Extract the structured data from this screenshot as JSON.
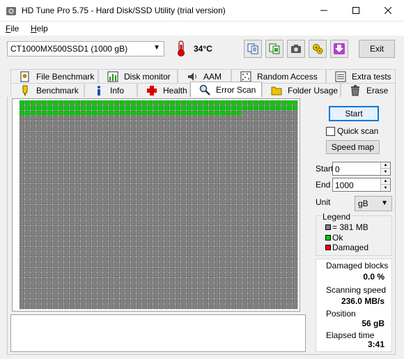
{
  "window": {
    "title": "HD Tune Pro 5.75 - Hard Disk/SSD Utility (trial version)",
    "controls": {
      "minimize": "—",
      "maximize": "☐",
      "close": "✕"
    }
  },
  "menu": [
    {
      "key": "F",
      "rest": "ile"
    },
    {
      "key": "H",
      "rest": "elp"
    }
  ],
  "toolbar": {
    "drive": "CT1000MX500SSD1 (1000 gB)",
    "temperature": "34°C",
    "exit_label": "Exit",
    "icons": [
      "copy-text-icon",
      "copy-image-icon",
      "camera-icon",
      "options-icon",
      "download-icon"
    ]
  },
  "tabs_back": [
    {
      "label": "File Benchmark",
      "icon": "file-benchmark-icon"
    },
    {
      "label": "Disk monitor",
      "icon": "disk-monitor-icon"
    },
    {
      "label": "AAM",
      "icon": "aam-icon"
    },
    {
      "label": "Random Access",
      "icon": "random-access-icon"
    },
    {
      "label": "Extra tests",
      "icon": "extra-tests-icon"
    }
  ],
  "tabs_front": [
    {
      "label": "Benchmark",
      "icon": "benchmark-icon"
    },
    {
      "label": "Info",
      "icon": "info-icon"
    },
    {
      "label": "Health",
      "icon": "health-icon"
    },
    {
      "label": "Error Scan",
      "icon": "error-scan-icon",
      "active": true
    },
    {
      "label": "Folder Usage",
      "icon": "folder-usage-icon"
    },
    {
      "label": "Erase",
      "icon": "erase-icon"
    }
  ],
  "scan": {
    "start_label": "Start",
    "quick_scan_label": "Quick scan",
    "quick_scan_checked": false,
    "speed_map_label": "Speed map",
    "range_start_label": "Start",
    "range_start_value": "0",
    "range_end_label": "End",
    "range_end_value": "1000",
    "unit_label": "Unit",
    "unit_value": "gB",
    "block_rows": 40,
    "block_cols": 50,
    "scanned_full_rows": 2,
    "scanned_partial_row_blocks": 40,
    "colors": {
      "pending": "#808080",
      "ok": "#00cc00",
      "damaged": "#ff0000",
      "grid_line": "#404040"
    }
  },
  "legend": {
    "title": "Legend",
    "block_size": "= 381 MB",
    "ok": "Ok",
    "damaged": "Damaged"
  },
  "stats": {
    "damaged_blocks_label": "Damaged blocks",
    "damaged_blocks_value": "0.0 %",
    "scanning_speed_label": "Scanning speed",
    "scanning_speed_value": "236.0 MB/s",
    "position_label": "Position",
    "position_value": "56 gB",
    "elapsed_label": "Elapsed time",
    "elapsed_value": "3:41"
  }
}
